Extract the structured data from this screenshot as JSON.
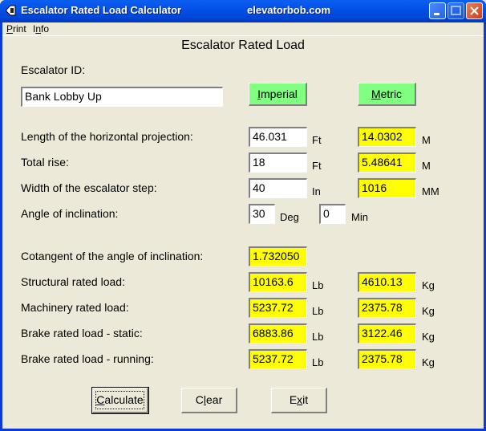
{
  "window": {
    "title": "Escalator Rated Load Calculator",
    "subtitle": "elevatorbob.com"
  },
  "menu": {
    "items": [
      {
        "label": "Print",
        "accel": "P",
        "rest": "rint"
      },
      {
        "label": "Info",
        "pre": "I",
        "accel": "n",
        "rest": "fo"
      }
    ]
  },
  "heading": "Escalator Rated Load",
  "escalator_id": {
    "label": "Escalator ID:",
    "value": "Bank Lobby Up"
  },
  "units_buttons": {
    "imperial": {
      "accel": "I",
      "rest": "mperial"
    },
    "metric": {
      "accel": "M",
      "rest": "etric"
    }
  },
  "inputs": [
    {
      "label": "Length of the horizontal projection:",
      "value": "46.031",
      "unit": "Ft",
      "metric_value": "14.0302",
      "metric_unit": "M"
    },
    {
      "label": "Total rise:",
      "value": "18",
      "unit": "Ft",
      "metric_value": "5.48641",
      "metric_unit": "M"
    },
    {
      "label": "Width of the escalator step:",
      "value": "40",
      "unit": "In",
      "metric_value": "1016",
      "metric_unit": "MM"
    }
  ],
  "angle": {
    "label": "Angle of inclination:",
    "deg": "30",
    "deg_unit": "Deg",
    "min": "0",
    "min_unit": "Min"
  },
  "cotangent": {
    "label": "Cotangent of the angle of inclination:",
    "value": "1.732050"
  },
  "results": [
    {
      "label": "Structural rated load:",
      "lb": "10163.6",
      "lb_unit": "Lb",
      "kg": "4610.13",
      "kg_unit": "Kg"
    },
    {
      "label": "Machinery rated load:",
      "lb": "5237.72",
      "lb_unit": "Lb",
      "kg": "2375.78",
      "kg_unit": "Kg"
    },
    {
      "label": "Brake rated load - static:",
      "lb": "6883.86",
      "lb_unit": "Lb",
      "kg": "3122.46",
      "kg_unit": "Kg"
    },
    {
      "label": "Brake rated load - running:",
      "lb": "5237.72",
      "lb_unit": "Lb",
      "kg": "2375.78",
      "kg_unit": "Kg"
    }
  ],
  "buttons": {
    "calculate": {
      "accel": "C",
      "rest": "alculate"
    },
    "clear": {
      "pre": "C",
      "accel": "l",
      "rest": "ear"
    },
    "exit": {
      "pre": "E",
      "accel": "x",
      "rest": "it"
    }
  }
}
